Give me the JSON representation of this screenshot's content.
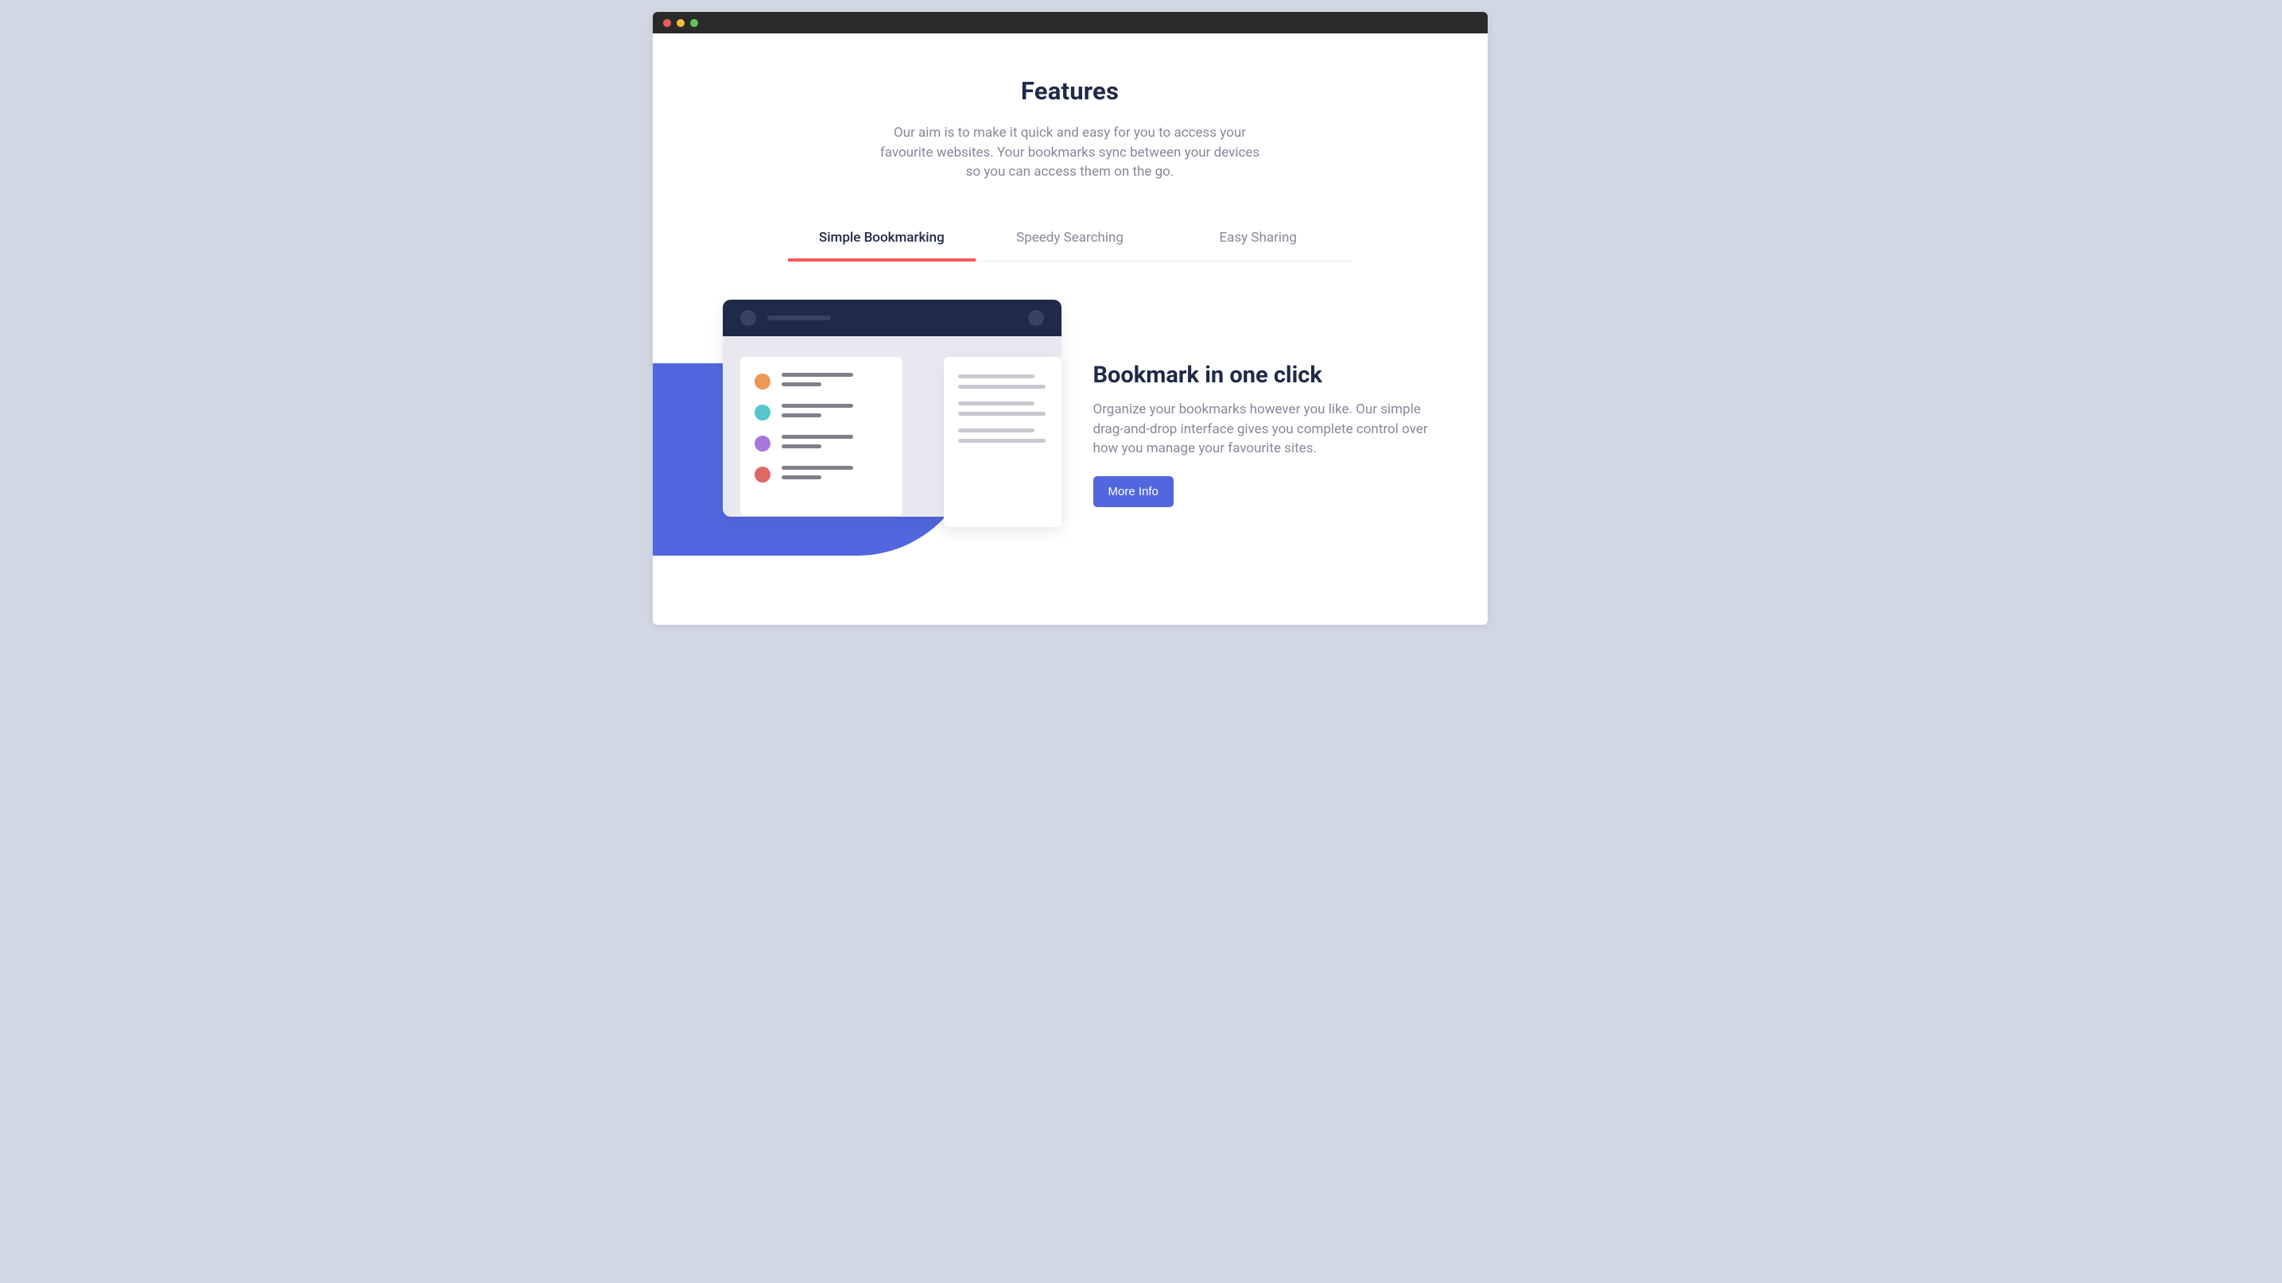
{
  "window": {
    "traffic_lights": [
      "close",
      "minimize",
      "zoom"
    ]
  },
  "features": {
    "title": "Features",
    "description": "Our aim is to make it quick and easy for you to access your favourite websites. Your bookmarks sync between your devices so you can access them on the go."
  },
  "tabs": [
    {
      "label": "Simple Bookmarking",
      "active": true
    },
    {
      "label": "Speedy Searching",
      "active": false
    },
    {
      "label": "Easy Sharing",
      "active": false
    }
  ],
  "feature_panel": {
    "title": "Bookmark in one click",
    "description": "Organize your bookmarks however you like. Our simple drag-and-drop interface gives you complete control over how you manage your favourite sites.",
    "button_label": "More Info"
  },
  "illustration": {
    "accent_color": "#5267df",
    "list_dots": [
      "#ec9857",
      "#58c4cc",
      "#a777de",
      "#e06767"
    ]
  }
}
